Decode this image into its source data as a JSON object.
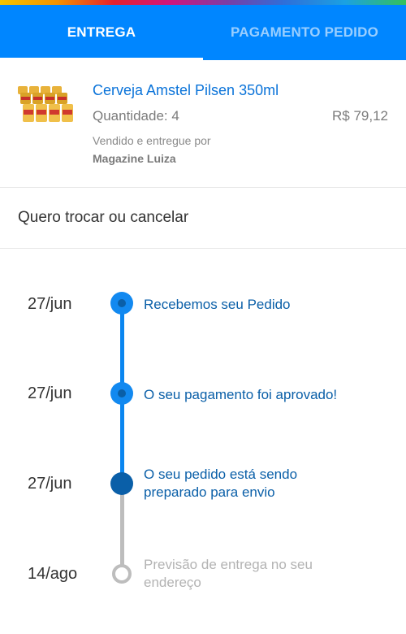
{
  "tabs": [
    {
      "label": "ENTREGA",
      "active": true
    },
    {
      "label": "PAGAMENTO PEDIDO",
      "active": false
    }
  ],
  "product": {
    "name": "Cerveja Amstel Pilsen 350ml",
    "quantity": "Quantidade: 4",
    "price": "R$ 79,12",
    "sold_by": "Vendido e entregue por",
    "seller": "Magazine Luiza",
    "image_icon": "beer-cans-pack-icon"
  },
  "exchange_label": "Quero trocar ou cancelar",
  "timeline": [
    {
      "date": "27/jun",
      "label": "Recebemos seu Pedido",
      "status": "done"
    },
    {
      "date": "27/jun",
      "label": "O seu pagamento foi aprovado!",
      "status": "done"
    },
    {
      "date": "27/jun",
      "label_line1": "O seu pedido está sendo",
      "label_line2": "preparado para envio",
      "status": "current"
    },
    {
      "date": "14/ago",
      "label_line1": "Previsão de entrega no seu",
      "label_line2": "endereço",
      "status": "future"
    }
  ],
  "colors": {
    "header_blue": "#0086ff",
    "link_blue": "#0a73d9",
    "timeline_blue": "#0a86f0",
    "timeline_dark": "#0a5fa8",
    "timeline_gray": "#bdbdbd"
  }
}
